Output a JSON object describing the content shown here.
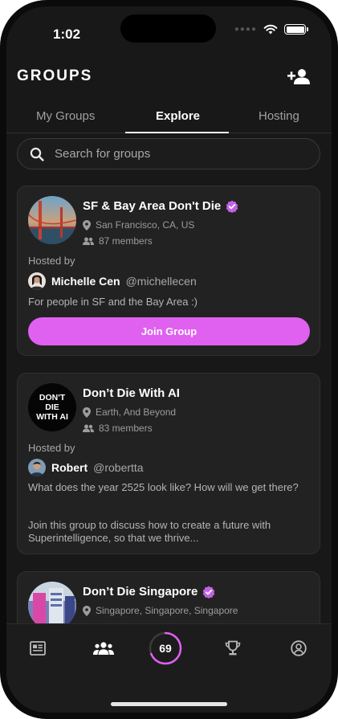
{
  "status_bar": {
    "time": "1:02"
  },
  "header": {
    "title": "GROUPS"
  },
  "tabs": [
    {
      "label": "My Groups",
      "active": false
    },
    {
      "label": "Explore",
      "active": true
    },
    {
      "label": "Hosting",
      "active": false
    }
  ],
  "search": {
    "placeholder": "Search for groups"
  },
  "hosted_by_label": "Hosted by",
  "groups": [
    {
      "name": "SF & Bay Area Don't Die",
      "verified": true,
      "location": "San Francisco, CA, US",
      "members": "87 members",
      "host_name": "Michelle Cen",
      "host_handle": "@michellecen",
      "description": "For people in SF and the Bay Area :)",
      "button_label": "Join Group"
    },
    {
      "name": "Don’t Die With AI",
      "verified": false,
      "logo_text": "DON'T DIE WITH AI",
      "location": "Earth, And Beyond",
      "members": "83 members",
      "host_name": "Robert",
      "host_handle": "@robertta",
      "description_p1": "What does the year 2525 look like? How will we get there?",
      "description_p2": "Join this group to discuss how to create a future with Superintelligence, so that we thrive..."
    },
    {
      "name": "Don’t Die Singapore",
      "verified": true,
      "location": "Singapore, Singapore, Singapore"
    }
  ],
  "bottom_nav": {
    "score": "69",
    "score_progress": 0.69
  },
  "colors": {
    "accent": "#e060f0",
    "background": "#181818",
    "card": "#222222"
  }
}
